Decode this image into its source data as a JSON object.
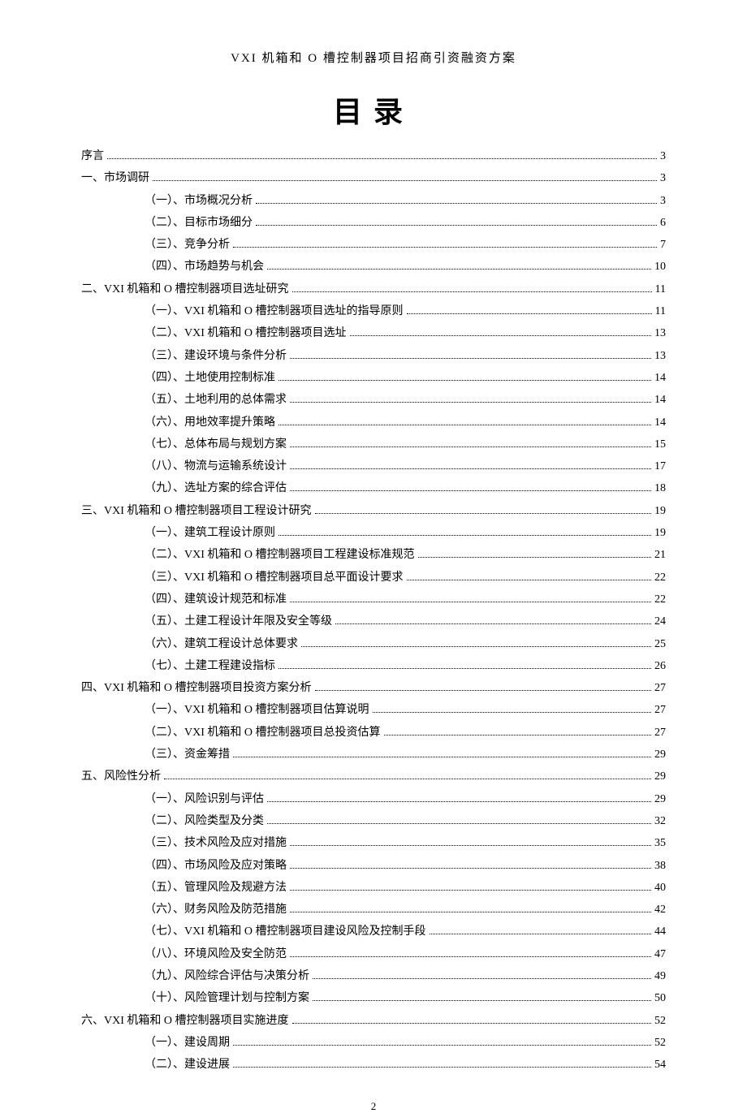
{
  "header": "VXI 机箱和 O 槽控制器项目招商引资融资方案",
  "title": "目录",
  "pageNumber": "2",
  "toc": [
    {
      "level": 1,
      "label": "序言",
      "page": "3"
    },
    {
      "level": 1,
      "label": "一、市场调研",
      "page": "3"
    },
    {
      "level": 2,
      "label": "（一）、市场概况分析",
      "page": "3"
    },
    {
      "level": 2,
      "label": "（二）、目标市场细分",
      "page": "6"
    },
    {
      "level": 2,
      "label": "（三）、竞争分析",
      "page": "7"
    },
    {
      "level": 2,
      "label": "（四）、市场趋势与机会",
      "page": "10"
    },
    {
      "level": 1,
      "label": "二、VXI 机箱和 O 槽控制器项目选址研究",
      "page": "11"
    },
    {
      "level": 2,
      "label": "（一）、VXI 机箱和 O 槽控制器项目选址的指导原则",
      "page": "11"
    },
    {
      "level": 2,
      "label": "（二）、VXI 机箱和 O 槽控制器项目选址",
      "page": "13"
    },
    {
      "level": 2,
      "label": "（三）、建设环境与条件分析",
      "page": "13"
    },
    {
      "level": 2,
      "label": "（四）、土地使用控制标准",
      "page": "14"
    },
    {
      "level": 2,
      "label": "（五）、土地利用的总体需求",
      "page": "14"
    },
    {
      "level": 2,
      "label": "（六）、用地效率提升策略",
      "page": "14"
    },
    {
      "level": 2,
      "label": "（七）、总体布局与规划方案",
      "page": "15"
    },
    {
      "level": 2,
      "label": "（八）、物流与运输系统设计",
      "page": "17"
    },
    {
      "level": 2,
      "label": "（九）、选址方案的综合评估",
      "page": "18"
    },
    {
      "level": 1,
      "label": "三、VXI 机箱和 O 槽控制器项目工程设计研究",
      "page": "19"
    },
    {
      "level": 2,
      "label": "（一）、建筑工程设计原则",
      "page": "19"
    },
    {
      "level": 2,
      "label": "（二）、VXI 机箱和 O 槽控制器项目工程建设标准规范",
      "page": "21"
    },
    {
      "level": 2,
      "label": "（三）、VXI 机箱和 O 槽控制器项目总平面设计要求",
      "page": "22"
    },
    {
      "level": 2,
      "label": "（四）、建筑设计规范和标准",
      "page": "22"
    },
    {
      "level": 2,
      "label": "（五）、土建工程设计年限及安全等级",
      "page": "24"
    },
    {
      "level": 2,
      "label": "（六）、建筑工程设计总体要求",
      "page": "25"
    },
    {
      "level": 2,
      "label": "（七）、土建工程建设指标",
      "page": "26"
    },
    {
      "level": 1,
      "label": "四、VXI 机箱和 O 槽控制器项目投资方案分析",
      "page": "27"
    },
    {
      "level": 2,
      "label": "（一）、VXI 机箱和 O 槽控制器项目估算说明",
      "page": "27"
    },
    {
      "level": 2,
      "label": "（二）、VXI 机箱和 O 槽控制器项目总投资估算",
      "page": "27"
    },
    {
      "level": 2,
      "label": "（三）、资金筹措",
      "page": "29"
    },
    {
      "level": 1,
      "label": "五、风险性分析",
      "page": "29"
    },
    {
      "level": 2,
      "label": "（一）、风险识别与评估",
      "page": "29"
    },
    {
      "level": 2,
      "label": "（二）、风险类型及分类",
      "page": "32"
    },
    {
      "level": 2,
      "label": "（三）、技术风险及应对措施",
      "page": "35"
    },
    {
      "level": 2,
      "label": "（四）、市场风险及应对策略",
      "page": "38"
    },
    {
      "level": 2,
      "label": "（五）、管理风险及规避方法",
      "page": "40"
    },
    {
      "level": 2,
      "label": "（六）、财务风险及防范措施",
      "page": "42"
    },
    {
      "level": 2,
      "label": "（七）、VXI 机箱和 O 槽控制器项目建设风险及控制手段",
      "page": "44"
    },
    {
      "level": 2,
      "label": "（八）、环境风险及安全防范",
      "page": "47"
    },
    {
      "level": 2,
      "label": "（九）、风险综合评估与决策分析",
      "page": "49"
    },
    {
      "level": 2,
      "label": "（十）、风险管理计划与控制方案",
      "page": "50"
    },
    {
      "level": 1,
      "label": "六、VXI 机箱和 O 槽控制器项目实施进度",
      "page": "52"
    },
    {
      "level": 2,
      "label": "（一）、建设周期",
      "page": "52"
    },
    {
      "level": 2,
      "label": "（二）、建设进展",
      "page": "54"
    }
  ]
}
